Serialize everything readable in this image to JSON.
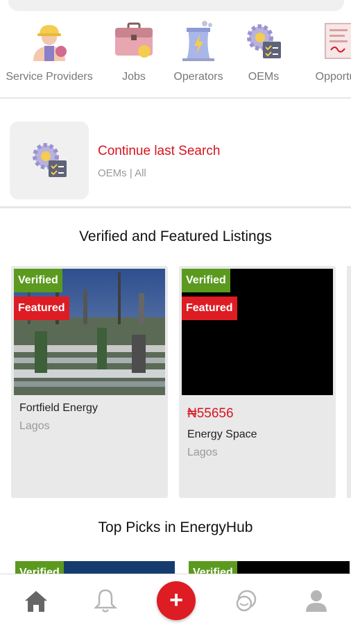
{
  "categories": [
    {
      "label": "Service Providers",
      "icon": "worker-icon"
    },
    {
      "label": "Jobs",
      "icon": "briefcase-icon"
    },
    {
      "label": "Operators",
      "icon": "power-plant-icon"
    },
    {
      "label": "OEMs",
      "icon": "gear-checklist-icon"
    },
    {
      "label": "Opportun",
      "icon": "document-icon"
    }
  ],
  "last_search": {
    "title": "Continue last Search",
    "subtitle": "OEMs | All",
    "icon": "gear-checklist-icon"
  },
  "verified_section": {
    "title": "Verified and Featured Listings",
    "listings": [
      {
        "verified": "Verified",
        "featured": "Featured",
        "name": "Fortfield Energy",
        "location": "Lagos",
        "image": "refinery-photo"
      },
      {
        "verified": "Verified",
        "featured": "Featured",
        "price": "₦55656",
        "name": "Energy Space",
        "location": "Lagos",
        "image": "black-placeholder"
      }
    ]
  },
  "top_picks_section": {
    "title": "Top Picks in EnergyHub",
    "peek_badges": [
      "Verified",
      "Verified"
    ]
  },
  "bottom_nav": {
    "items": [
      "home-icon",
      "bell-icon",
      "add-icon",
      "chat-icon",
      "profile-icon"
    ],
    "add_label": "+"
  },
  "colors": {
    "accent_red": "#dd1c24",
    "verified_green": "#5b9a1e",
    "muted_text": "#999999"
  }
}
